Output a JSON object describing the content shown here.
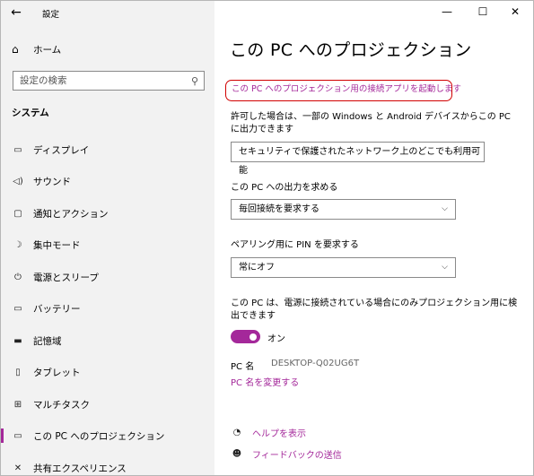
{
  "window": {
    "title": "設定",
    "back_icon": "←",
    "minimize": "—",
    "maximize": "☐",
    "close": "✕"
  },
  "sidebar": {
    "home_label": "ホーム",
    "search_placeholder": "設定の検索",
    "section_label": "システム",
    "items": [
      {
        "label": "ディスプレイ",
        "icon": "display-icon"
      },
      {
        "label": "サウンド",
        "icon": "sound-icon"
      },
      {
        "label": "通知とアクション",
        "icon": "notifications-icon"
      },
      {
        "label": "集中モード",
        "icon": "focus-assist-icon"
      },
      {
        "label": "電源とスリープ",
        "icon": "power-icon"
      },
      {
        "label": "バッテリー",
        "icon": "battery-icon"
      },
      {
        "label": "記憶域",
        "icon": "storage-icon"
      },
      {
        "label": "タブレット",
        "icon": "tablet-icon"
      },
      {
        "label": "マルチタスク",
        "icon": "multitasking-icon"
      },
      {
        "label": "この PC へのプロジェクション",
        "icon": "projection-icon",
        "active": true
      },
      {
        "label": "共有エクスペリエンス",
        "icon": "shared-experiences-icon"
      }
    ]
  },
  "main": {
    "title": "この PC へのプロジェクション",
    "launch_link": "この PC へのプロジェクション用の接続アプリを起動します",
    "allow_label": "許可した場合は、一部の Windows と Android デバイスからこの PC に出力できます",
    "allow_select": "セキュリティで保護されたネットワーク上のどこでも利用可能",
    "ask_label": "この PC への出力を求める",
    "ask_select": "毎回接続を要求する",
    "pin_label": "ペアリング用に PIN を要求する",
    "pin_select": "常にオフ",
    "power_label": "この PC は、電源に接続されている場合にのみプロジェクション用に検出できます",
    "toggle_state": "オン",
    "pc_name_key": "PC 名",
    "pc_name_value": "DESKTOP-Q02UG6T",
    "rename_link": "PC 名を変更する",
    "help_link": "ヘルプを表示",
    "feedback_link": "フィードバックの送信"
  },
  "colors": {
    "accent": "#a4289a",
    "highlight_border": "#d10000",
    "sidebar_bg": "#f2f2f2"
  }
}
